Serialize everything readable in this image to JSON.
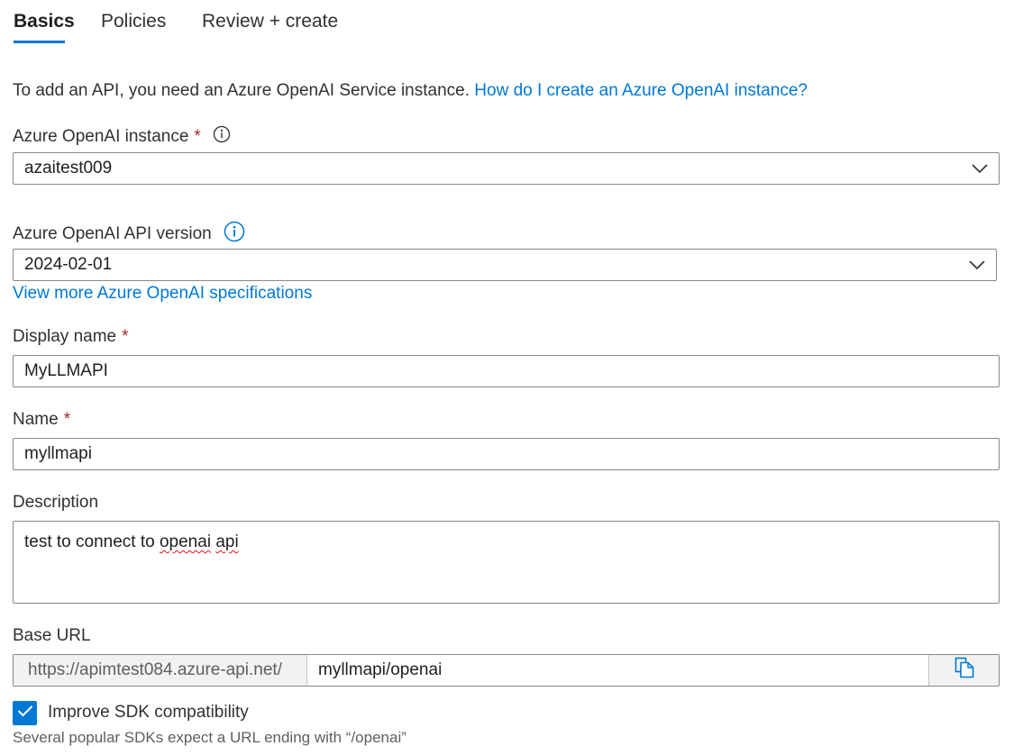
{
  "tabs": [
    {
      "label": "Basics",
      "active": true
    },
    {
      "label": "Policies",
      "active": false
    },
    {
      "label": "Review + create",
      "active": false
    }
  ],
  "intro": {
    "text": "To add an API, you need an Azure OpenAI Service instance.",
    "link": "How do I create an Azure OpenAI instance?"
  },
  "instance": {
    "label": "Azure OpenAI instance",
    "required_mark": "*",
    "value": "azaitest009"
  },
  "api_version": {
    "label": "Azure OpenAI API version",
    "value": "2024-02-01",
    "link": "View more Azure OpenAI specifications"
  },
  "display_name": {
    "label": "Display name",
    "required_mark": "*",
    "value": "MyLLMAPI"
  },
  "name": {
    "label": "Name",
    "required_mark": "*",
    "value": "myllmapi"
  },
  "description": {
    "label": "Description",
    "value_prefix": "test to connect to ",
    "value_word1": "openai",
    "value_space": " ",
    "value_word2": "api"
  },
  "base_url": {
    "label": "Base URL",
    "prefix": "https://apimtest084.azure-api.net/",
    "suffix": "myllmapi/openai"
  },
  "sdk": {
    "label": "Improve SDK compatibility",
    "checked": true,
    "hint": "Several popular SDKs expect a URL ending with “/openai”"
  },
  "icons": {
    "info": "info-icon",
    "dropdown": "chevron-down-icon",
    "copy": "copy-icon",
    "check": "checkmark-icon"
  },
  "colors": {
    "accent": "#0078d4",
    "required": "#a4262c",
    "border": "#8a8886"
  }
}
